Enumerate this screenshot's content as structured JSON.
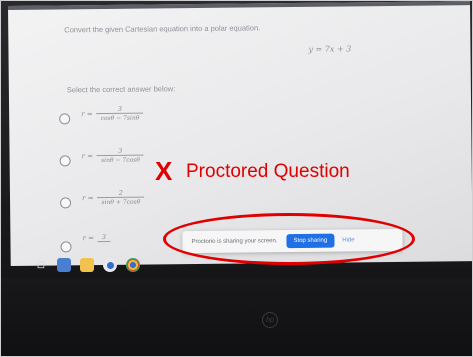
{
  "question": {
    "prompt": "Convert the given Cartesian equation into a polar equation.",
    "equation": "y = 7x + 3",
    "instruction": "Select the correct answer below:"
  },
  "options": [
    {
      "lhs": "r =",
      "numerator": "3",
      "denominator": "cosθ − 7sinθ"
    },
    {
      "lhs": "r =",
      "numerator": "3",
      "denominator": "sinθ − 7cosθ"
    },
    {
      "lhs": "r =",
      "numerator": "2",
      "denominator": "sinθ + 7cosθ"
    },
    {
      "lhs": "r =",
      "numerator": "3",
      "denominator": ""
    }
  ],
  "screen_share": {
    "message": "Proctorio is sharing your screen.",
    "stop_label": "Stop sharing",
    "hide_label": "Hide"
  },
  "annotation": {
    "mark": "X",
    "label": "Proctored Question",
    "color": "#e00000"
  },
  "taskbar": {
    "icons": [
      "task-view-icon",
      "files-icon",
      "folder-icon",
      "chrome-icon",
      "google-icon"
    ]
  },
  "colors": {
    "accent": "#1f6fe6",
    "annotation": "#e00000"
  }
}
